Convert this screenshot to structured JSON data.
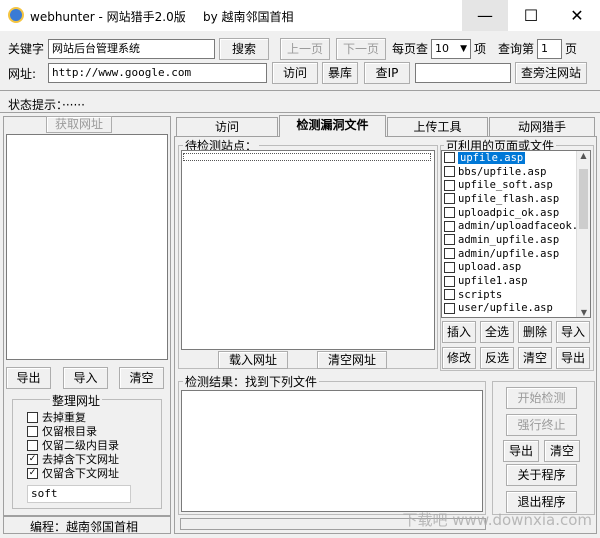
{
  "window": {
    "app_name": "webhunter",
    "title_suffix": " - 网站猎手2.0版",
    "by_text": "by 越南邻国首相",
    "min_icon": "—",
    "max_icon": "☐",
    "close_icon": "✕"
  },
  "search": {
    "keyword_label": "关键字",
    "keyword_value": "网站后台管理系统",
    "search_button": "搜索",
    "prev_page": "上一页",
    "next_page": "下一页",
    "per_page_label": "每页查",
    "per_page_value": "10",
    "per_page_unit": "项",
    "query_page_label": "查询第",
    "query_page_value": "1",
    "page_unit": "页"
  },
  "url_row": {
    "url_label": "网址:",
    "url_value": "http://www.google.com",
    "visit_button": "访问",
    "baoku_button": "暴库",
    "check_ip_button": "查IP",
    "ip_value": "",
    "neighbor_button": "查旁注网站"
  },
  "status": {
    "label": "状态提示：······"
  },
  "left_panel": {
    "fetch_button": "获取网址",
    "export_button": "导出",
    "import_button": "导入",
    "clear_button": "清空",
    "organize_title": "整理网址",
    "options": [
      {
        "label": "去掉重复",
        "checked": false
      },
      {
        "label": "仅留根目录",
        "checked": false
      },
      {
        "label": "仅留二级内目录",
        "checked": false
      },
      {
        "label": "去掉含下文网址",
        "checked": true
      },
      {
        "label": "仅留含下文网址",
        "checked": true
      }
    ],
    "filter_value": "soft",
    "footer": "编程：越南邻国首相"
  },
  "tabs": [
    {
      "label": "访问"
    },
    {
      "label": "检测漏洞文件"
    },
    {
      "label": "上传工具"
    },
    {
      "label": "动网猎手"
    }
  ],
  "sites": {
    "title": "待检测站点：",
    "load_button": "载入网址",
    "clear_button": "清空网址"
  },
  "files": {
    "title": "可利用的页面或文件",
    "items": [
      {
        "label": "upfile.asp",
        "checked": false,
        "selected": true
      },
      {
        "label": "bbs/upfile.asp",
        "checked": false,
        "selected": false
      },
      {
        "label": "upfile_soft.asp",
        "checked": false,
        "selected": false
      },
      {
        "label": "upfile_flash.asp",
        "checked": false,
        "selected": false
      },
      {
        "label": "uploadpic_ok.asp",
        "checked": false,
        "selected": false
      },
      {
        "label": "admin/uploadfaceok.a",
        "checked": false,
        "selected": false
      },
      {
        "label": "admin_upfile.asp",
        "checked": false,
        "selected": false
      },
      {
        "label": "admin/upfile.asp",
        "checked": false,
        "selected": false
      },
      {
        "label": "upload.asp",
        "checked": false,
        "selected": false
      },
      {
        "label": "upfile1.asp",
        "checked": false,
        "selected": false
      },
      {
        "label": "scripts",
        "checked": false,
        "selected": false
      },
      {
        "label": "user/upfile.asp",
        "checked": false,
        "selected": false
      }
    ],
    "buttons_row1": [
      "插入",
      "全选",
      "删除",
      "导入"
    ],
    "buttons_row2": [
      "修改",
      "反选",
      "清空",
      "导出"
    ]
  },
  "results": {
    "title": "检测结果：找到下列文件",
    "start_button": "开始检测",
    "stop_button": "强行终止",
    "export_button": "导出",
    "clear_button": "清空",
    "about_button": "关于程序",
    "exit_button": "退出程序"
  },
  "watermark": "下载吧 www.downxia.com"
}
